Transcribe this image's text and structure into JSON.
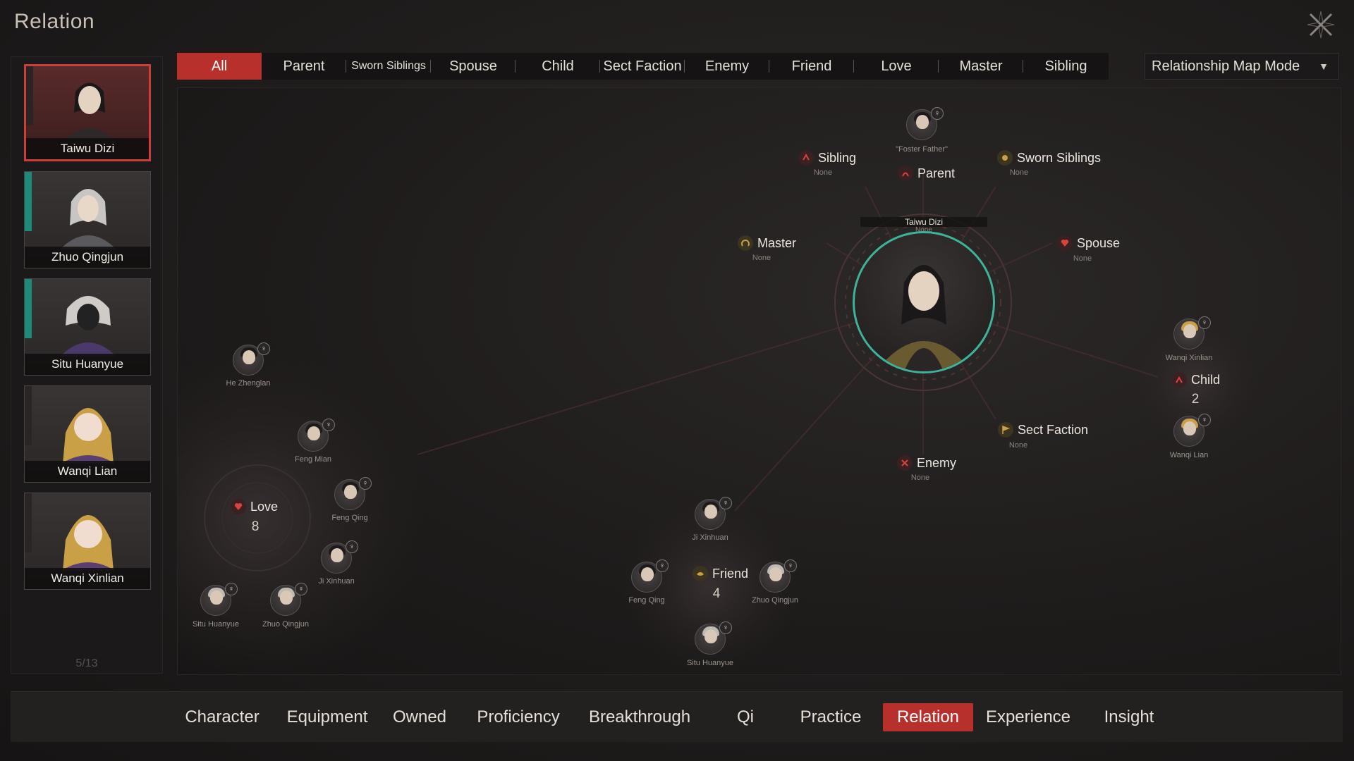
{
  "window": {
    "title": "Relation"
  },
  "characters": [
    {
      "name": "Taiwu Dizi",
      "selected": true,
      "stripe": "none"
    },
    {
      "name": "Zhuo Qingjun",
      "selected": false,
      "stripe": "teal"
    },
    {
      "name": "Situ Huanyue",
      "selected": false,
      "stripe": "teal"
    },
    {
      "name": "Wanqi Lian",
      "selected": false,
      "stripe": "none"
    },
    {
      "name": "Wanqi Xinlian",
      "selected": false,
      "stripe": "none"
    }
  ],
  "page_count": "5/13",
  "filters": [
    {
      "label": "All",
      "active": true
    },
    {
      "label": "Parent",
      "active": false
    },
    {
      "label": "Sworn Siblings",
      "active": false
    },
    {
      "label": "Spouse",
      "active": false
    },
    {
      "label": "Child",
      "active": false
    },
    {
      "label": "Sect Faction",
      "active": false
    },
    {
      "label": "Enemy",
      "active": false
    },
    {
      "label": "Friend",
      "active": false
    },
    {
      "label": "Love",
      "active": false
    },
    {
      "label": "Master",
      "active": false
    },
    {
      "label": "Sibling",
      "active": false
    }
  ],
  "mode_select": {
    "label": "Relationship Map Mode"
  },
  "map": {
    "center": {
      "name": "Taiwu Dizi",
      "sub": "None"
    },
    "nodes": {
      "sibling": {
        "label": "Sibling",
        "sub": "None"
      },
      "parent": {
        "label": "Parent",
        "avatar_name": "\"Foster Father\""
      },
      "sworn": {
        "label": "Sworn Siblings",
        "sub": "None"
      },
      "master": {
        "label": "Master",
        "sub": "None"
      },
      "spouse": {
        "label": "Spouse",
        "sub": "None"
      },
      "sect": {
        "label": "Sect Faction",
        "sub": "None"
      },
      "enemy": {
        "label": "Enemy",
        "sub": "None"
      },
      "child": {
        "label": "Child",
        "count": "2"
      },
      "love": {
        "label": "Love",
        "count": "8"
      },
      "friend": {
        "label": "Friend",
        "count": "4"
      }
    },
    "avatars": {
      "he_zhenglan": "He Zhenglan",
      "feng_mian": "Feng Mian",
      "feng_qing_love": "Feng Qing",
      "ji_xinhuan_love": "Ji Xinhuan",
      "situ_love": "Situ Huanyue",
      "zhuo_love": "Zhuo Qingjun",
      "ji_xinhuan_friend": "Ji Xinhuan",
      "feng_qing_friend": "Feng Qing",
      "zhuo_friend": "Zhuo Qingjun",
      "situ_friend": "Situ Huanyue",
      "wanqi_xinlian": "Wanqi Xinlian",
      "wanqi_lian": "Wanqi Lian"
    },
    "gender_symbol": "♀"
  },
  "bottom_tabs": [
    {
      "label": "Character",
      "active": false
    },
    {
      "label": "Equipment",
      "active": false
    },
    {
      "label": "Owned",
      "active": false
    },
    {
      "label": "Proficiency",
      "active": false
    },
    {
      "label": "Breakthrough",
      "active": false
    },
    {
      "label": "Qi",
      "active": false
    },
    {
      "label": "Practice",
      "active": false
    },
    {
      "label": "Relation",
      "active": true
    },
    {
      "label": "Experience",
      "active": false
    },
    {
      "label": "Insight",
      "active": false
    }
  ],
  "colors": {
    "accent": "#b8302c",
    "teal": "#3fb39a"
  }
}
